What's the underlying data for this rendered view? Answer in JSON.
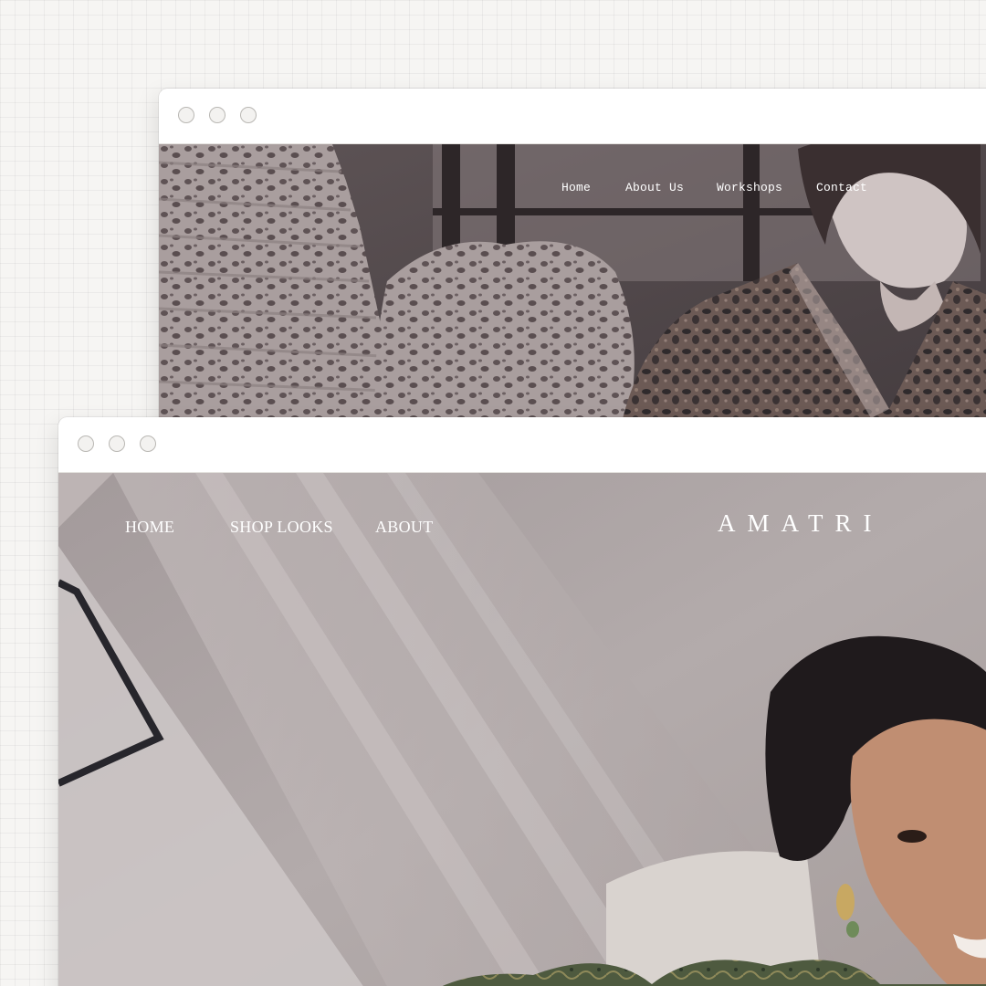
{
  "windows": {
    "back": {
      "nav": [
        "Home",
        "About Us",
        "Workshops",
        "Contact"
      ]
    },
    "front": {
      "brand": "AMATRI",
      "nav": [
        "HOME",
        "SHOP LOOKS",
        "ABOUT"
      ]
    }
  },
  "colors": {
    "page_background": "#f6f5f3",
    "window_chrome": "#ffffff",
    "back_hero_tint": "#6f6465",
    "front_hero_tint": "#a9a1a1"
  },
  "icons": {
    "window_controls": [
      "window-dot-icon",
      "window-dot-icon",
      "window-dot-icon"
    ]
  }
}
